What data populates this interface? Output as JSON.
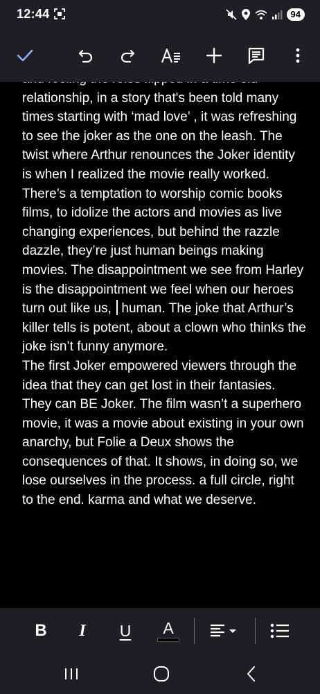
{
  "status_bar": {
    "time": "12:44",
    "battery": "94",
    "icons": [
      "screenshot-icon",
      "mute-icon",
      "location-icon",
      "wifi-icon",
      "signal-icon"
    ]
  },
  "toolbar": {
    "icons": [
      "check-icon",
      "undo-icon",
      "redo-icon",
      "text-format-icon",
      "add-icon",
      "comment-icon",
      "more-options-icon"
    ]
  },
  "document": {
    "paragraph_1": "and feeling the roles flipped in a time old relationship, in a story that's been told many times starting with ‘mad love’ , it was refreshing to see the joker as the one on the leash.  The twist where Arthur renounces the Joker identity is when I realized the movie really worked. There’s a temptation to worship comic books films, to idolize the actors and movies as live changing experiences, but behind the razzle dazzle, they’re just human beings making movies. The disappointment we see from Harley is the disappointment we feel when our heroes turn out like us,",
    "paragraph_1_after_cursor": "human. The joke that Arthur’s killer tells is potent, about a clown who thinks the joke isn’t funny anymore.",
    "paragraph_2": "The first Joker empowered viewers through the idea that they can get lost in their fantasies. They can BE Joker. The film wasn’t a superhero movie, it was a movie about existing in your own anarchy, but Folie a Deux shows the consequences of that. It shows, in doing so, we lose ourselves in the process. a full circle, right to the end.  karma and what we deserve."
  },
  "format_bar": {
    "bold_label": "B",
    "italic_label": "I",
    "underline_label": "U",
    "text_color_label": "A",
    "icons": [
      "align-icon",
      "bulleted-list-icon"
    ]
  },
  "nav_bar": {
    "icons": [
      "recent-apps-icon",
      "home-icon",
      "back-icon"
    ]
  },
  "colors": {
    "bar_background": "#1f1f23",
    "document_background": "#000000",
    "accent": "#8ab4f8",
    "text": "#ffffff"
  }
}
